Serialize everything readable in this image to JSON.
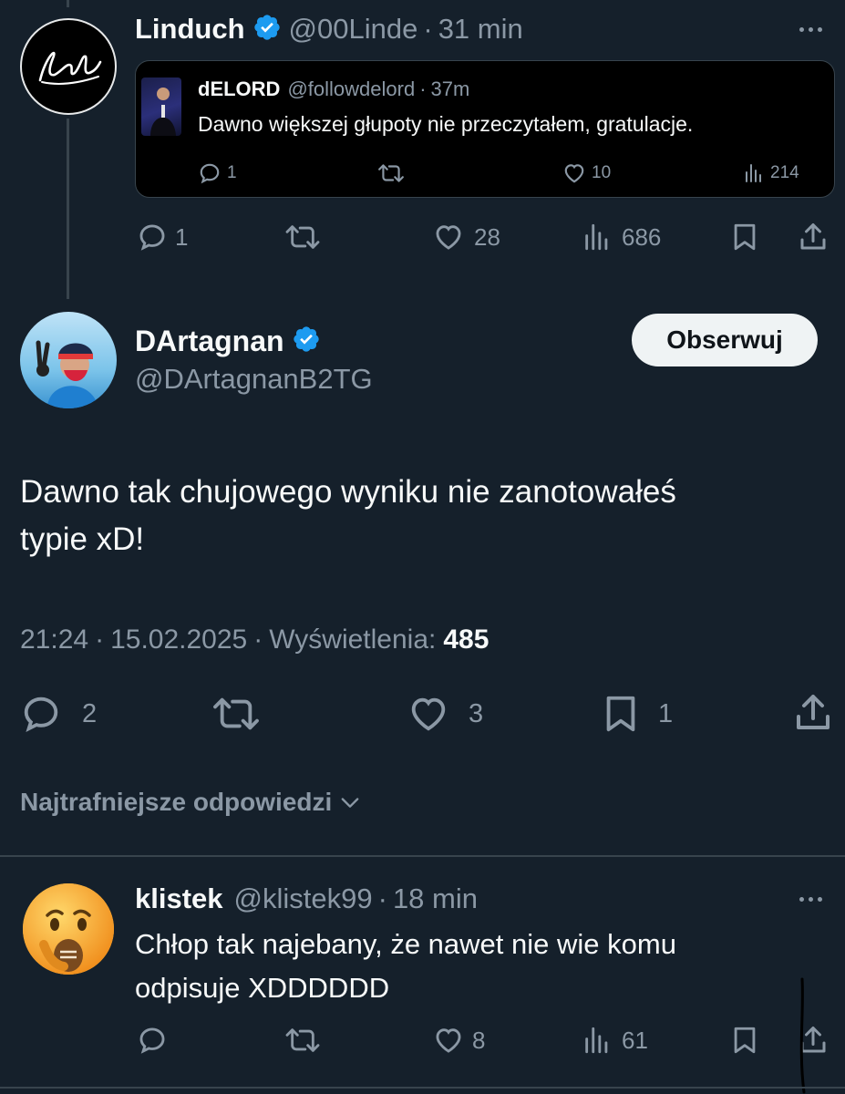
{
  "first_tweet": {
    "author_name": "Linduch",
    "handle": "@00Linde",
    "time": "31 min",
    "avatar_text": "Linde",
    "actions": {
      "replies": "1",
      "likes": "28",
      "views": "686"
    }
  },
  "quoted_tweet": {
    "author_name": "dELORD",
    "handle": "@followdelord",
    "time": "37m",
    "text": "Dawno większej głupoty nie przeczytałem, gratulacje.",
    "actions": {
      "replies": "1",
      "likes": "10",
      "views": "214"
    }
  },
  "main_tweet": {
    "author_name": "DArtagnan",
    "handle": "@DArtagnanB2TG",
    "follow_label": "Obserwuj",
    "text_line1": "Dawno tak chujowego wyniku nie zanotowałeś",
    "text_line2": "typie xD!",
    "time": "21:24",
    "date": "15.02.2025",
    "views_label": "Wyświetlenia:",
    "views_count": "485",
    "actions": {
      "replies": "2",
      "likes": "3",
      "bookmarks": "1"
    }
  },
  "replies_section": {
    "sort_label": "Najtrafniejsze odpowiedzi"
  },
  "reply": {
    "author_name": "klistek",
    "handle": "@klistek99",
    "time": "18 min",
    "text_line1": "Chłop tak najebany, że nawet nie wie komu",
    "text_line2": "odpisuje XDDDDDD",
    "actions": {
      "likes": "8",
      "views": "61"
    }
  },
  "colors": {
    "background": "#15202b",
    "verified_blue": "#1d9bf0",
    "muted": "#8b98a5",
    "border": "#38444d"
  }
}
